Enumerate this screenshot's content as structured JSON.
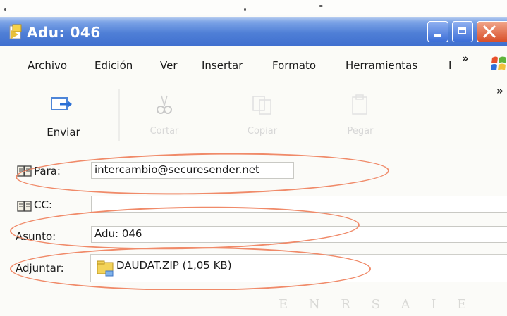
{
  "window": {
    "title": "Adu: 046",
    "accent_color": "#3f6fcf",
    "close_color": "#d9502a"
  },
  "menu": {
    "items": [
      "Archivo",
      "Edición",
      "Ver",
      "Insertar",
      "Formato",
      "Herramientas",
      "I"
    ],
    "overflow": "»"
  },
  "toolbar": {
    "overflow": "»",
    "buttons": [
      {
        "label": "Enviar",
        "icon": "send-icon",
        "enabled": true
      },
      {
        "label": "Cortar",
        "icon": "cut-icon",
        "enabled": false
      },
      {
        "label": "Copiar",
        "icon": "copy-icon",
        "enabled": false
      },
      {
        "label": "Pegar",
        "icon": "paste-icon",
        "enabled": false
      }
    ]
  },
  "form": {
    "to_label": "Para:",
    "to_value": "intercambio@securesender.net",
    "cc_label": "CC:",
    "cc_value": "",
    "subject_label": "Asunto:",
    "subject_value": "Adu: 046",
    "attach_label": "Adjuntar:",
    "attach_value": "DAUDAT.ZIP (1,05 KB)"
  },
  "annotation_color": "#f08a69",
  "footer_ghost_text": "E N R S A I E"
}
